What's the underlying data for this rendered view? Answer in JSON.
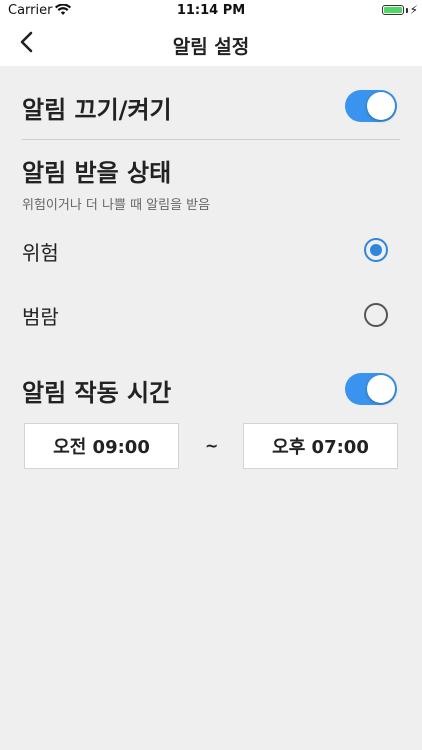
{
  "status_bar": {
    "carrier": "Carrier",
    "time": "11:14 PM",
    "battery_color": "#4cd964"
  },
  "nav": {
    "title": "알림 설정",
    "back_icon": "chevron-left-icon"
  },
  "notification_toggle": {
    "label": "알림 끄기/켜기",
    "on": true
  },
  "alert_state": {
    "title": "알림 받을 상태",
    "subtitle": "위험이거나 더 나쁠 때 알림을 받음",
    "options": [
      {
        "label": "위험",
        "selected": true
      },
      {
        "label": "범람",
        "selected": false
      }
    ]
  },
  "active_hours": {
    "label": "알림 작동 시간",
    "on": true,
    "start": "오전 09:00",
    "separator": "~",
    "end": "오후 07:00"
  },
  "colors": {
    "accent": "#3a94ef",
    "background": "#efefef"
  }
}
